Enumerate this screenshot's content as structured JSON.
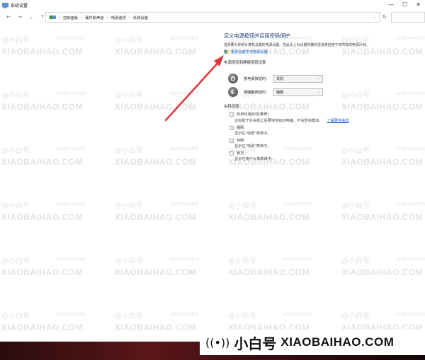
{
  "window": {
    "title": "系统设置",
    "min_glyph": "—",
    "max_glyph": "☐",
    "close_glyph": "✕"
  },
  "nav": {
    "back_glyph": "←",
    "forward_glyph": "→",
    "down_glyph": "⌄",
    "up_glyph": "↑",
    "breadcrumbs": [
      "控制面板",
      "硬件和声音",
      "电源选项",
      "系统设置"
    ],
    "sep_glyph": "›",
    "drop_glyph": "⌄",
    "refresh_glyph": "↻"
  },
  "main": {
    "heading": "定义电源按钮并启用密码保护",
    "description": "选择要为你的计算机设置的电源设置。在此页上对设置所做的更改将应用于你所有的电源计划。",
    "change_link": "更改当前不可用的设置",
    "power_section_title": "电源按钮和睡眠按钮设置",
    "rows": [
      {
        "label": "按电源按钮时:",
        "value": "关机",
        "chevron": "⌄"
      },
      {
        "label": "按睡眠按钮时:",
        "value": "睡眠",
        "chevron": "⌄"
      }
    ],
    "shutdown_section_title": "关机设置",
    "options": [
      {
        "label": "启用快速启动(推荐)",
        "desc": "这有助于在关机之后更快地启动电脑。不会影响重启。",
        "link": "了解更多信息"
      },
      {
        "label": "睡眠",
        "desc": "显示在\"电源\"菜单中。"
      },
      {
        "label": "休眠",
        "desc": "显示在\"电源\"菜单中。"
      },
      {
        "label": "锁定",
        "desc": "显示在用户头像菜单中。"
      }
    ]
  },
  "watermark": {
    "line1": "@小白号",
    "line1b": "来访要多科技发表",
    "line2": "XIAOBAIHAO.COM"
  },
  "brand": {
    "icon": "((•))",
    "cn": "小白号",
    "en": "XIAOBAIHAO.COM"
  },
  "colors": {
    "heading": "#1e3e7a",
    "link": "#0a58ca",
    "arrow": "#e03a3a"
  }
}
